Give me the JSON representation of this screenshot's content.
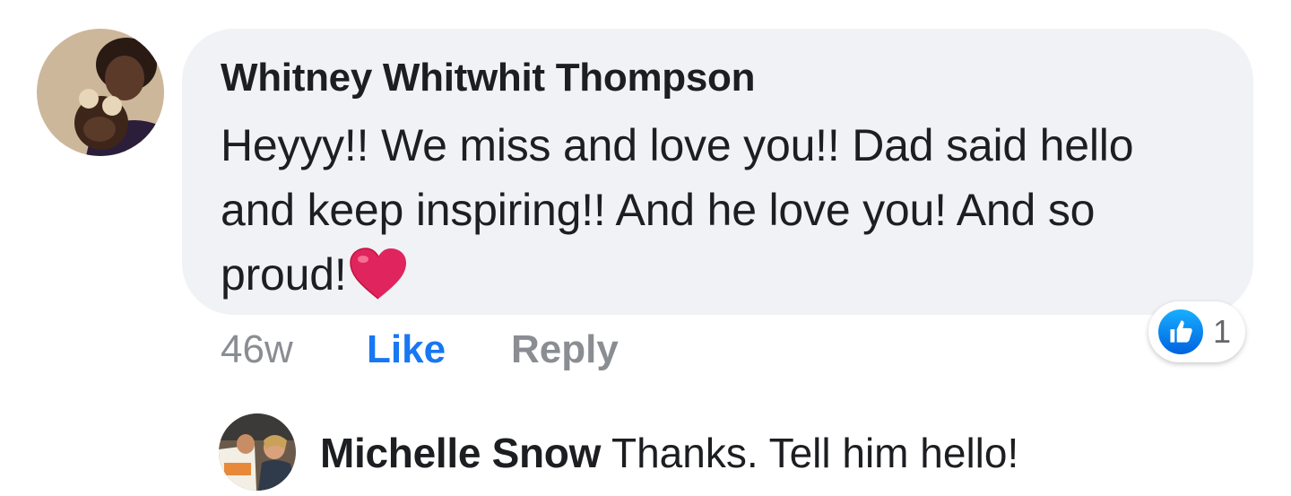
{
  "comment": {
    "author": "Whitney Whitwhit Thompson",
    "text": "Heyyy!! We miss and love you!! Dad said hello and keep inspiring!! And he love you! And so proud!",
    "emoji": "heart-emoji",
    "time": "46w",
    "like_label": "Like",
    "reply_label": "Reply",
    "reaction_count": "1",
    "reaction_type": "like-reaction-icon"
  },
  "reply": {
    "author": "Michelle Snow",
    "text": "Thanks. Tell him hello!"
  },
  "colors": {
    "bubble": "#f0f2f5",
    "text": "#1c1e21",
    "link_blue": "#1877f2",
    "muted": "#8a8d91",
    "heart_red": "#e0245e"
  }
}
